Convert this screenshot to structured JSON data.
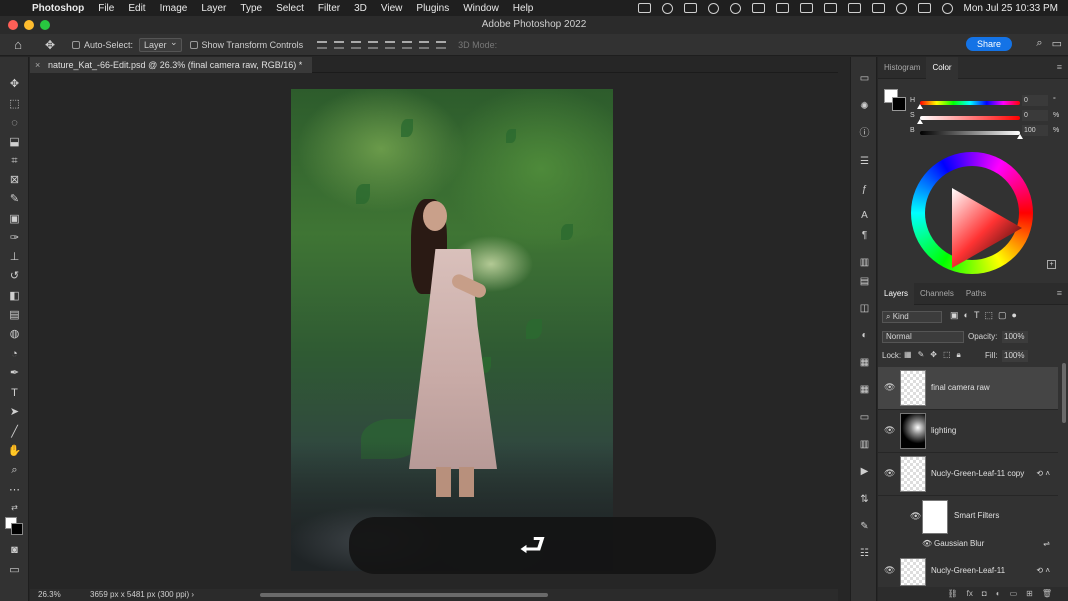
{
  "menubar": {
    "app_name": "Photoshop",
    "menus": [
      "File",
      "Edit",
      "Image",
      "Layer",
      "Type",
      "Select",
      "Filter",
      "3D",
      "View",
      "Plugins",
      "Window",
      "Help"
    ],
    "clock": "Mon Jul 25  10:33 PM"
  },
  "window": {
    "title": "Adobe Photoshop 2022"
  },
  "options": {
    "auto_select_label": "Auto-Select:",
    "auto_select_value": "Layer",
    "transform_label": "Show Transform Controls",
    "mode3d_label": "3D Mode:",
    "share_label": "Share"
  },
  "document": {
    "tab_title": "nature_Kat_-66-Edit.psd @ 26.3% (final camera raw, RGB/16) *",
    "close_glyph": "×"
  },
  "undo_overlay": {
    "glyph": "⮐"
  },
  "statusbar": {
    "zoom": "26.3%",
    "doc_size": "3659 px x 5481 px (300 ppi)",
    "arrow": "›"
  },
  "color_panel": {
    "tabs": [
      "Histogram",
      "Color"
    ],
    "active_tab": "Color",
    "sliders": [
      {
        "label": "H",
        "value": "0",
        "unit": "°",
        "level": 0
      },
      {
        "label": "S",
        "value": "0",
        "unit": "%",
        "level": 0
      },
      {
        "label": "B",
        "value": "100",
        "unit": "%",
        "level": 1
      }
    ]
  },
  "layers_panel": {
    "tabs": [
      "Layers",
      "Channels",
      "Paths"
    ],
    "active_tab": "Layers",
    "kind_label": "Kind",
    "blend_mode": "Normal",
    "opacity_label": "Opacity:",
    "opacity_value": "100%",
    "lock_label": "Lock:",
    "fill_label": "Fill:",
    "fill_value": "100%",
    "layers": [
      {
        "name": "final camera raw",
        "selected": true
      },
      {
        "name": "lighting",
        "selected": false
      },
      {
        "name": "Nucly-Green-Leaf-11 copy",
        "selected": false
      },
      {
        "name": "Nucly-Green-Leaf-11",
        "selected": false
      }
    ],
    "smart_filters_label": "Smart Filters",
    "filter_name": "Gaussian Blur"
  },
  "colors": {
    "accent": "#1473e6",
    "panel_bg": "#323232",
    "canvas_bg": "#262626"
  },
  "icons": {
    "home": "home-icon",
    "move": "move-tool-icon",
    "search": "search-icon",
    "eye": "eye-icon"
  }
}
